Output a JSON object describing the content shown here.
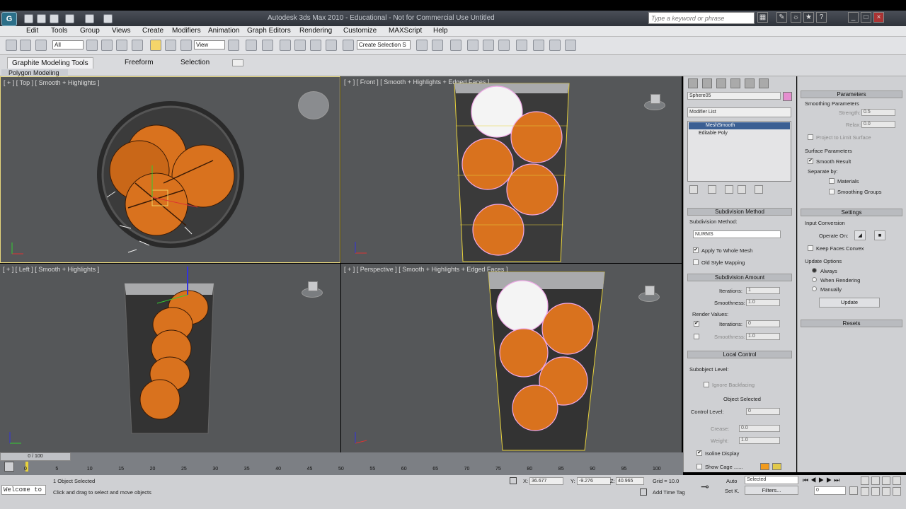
{
  "window": {
    "title": "Autodesk 3ds Max  2010 - Educational - Not for Commercial Use    Untitled",
    "search_placeholder": "Type a keyword or phrase"
  },
  "menu": [
    "Edit",
    "Tools",
    "Group",
    "Views",
    "Create",
    "Modifiers",
    "Animation",
    "Graph Editors",
    "Rendering",
    "Customize",
    "MAXScript",
    "Help"
  ],
  "toolbar": {
    "filter_value": "All",
    "view_value": "View",
    "selection_set_value": "Create Selection S"
  },
  "ribbon": {
    "tabs": [
      "Graphite Modeling Tools",
      "Freeform",
      "Selection"
    ],
    "active_tab": "Graphite Modeling Tools",
    "sub_label": "Polygon Modeling"
  },
  "viewports": {
    "top": "[ + ] [ Top ] [ Smooth + Highlights ]",
    "front": "[ + ] [ Front ] [ Smooth + Highlights + Edged Faces ]",
    "left": "[ + ] [ Left ] [ Smooth + Highlights ]",
    "perspective": "[ + ] [ Perspective ] [ Smooth + Highlights + Edged Faces ]"
  },
  "command_panel": {
    "object_name": "Sphere05",
    "object_color": "#e58ecf",
    "modifier_list_label": "Modifier List",
    "stack": [
      "MeshSmooth",
      "Editable Poly"
    ],
    "subdivision_method": {
      "header": "Subdivision Method",
      "label": "Subdivision Method:",
      "value": "NURMS",
      "apply_whole_mesh": "Apply To Whole Mesh",
      "old_style": "Old Style Mapping"
    },
    "subdivision_amount": {
      "header": "Subdivision Amount",
      "iterations_label": "Iterations:",
      "iterations": "1",
      "smoothness_label": "Smoothness:",
      "smoothness": "1.0",
      "render_values": "Render Values:",
      "r_iterations": "0",
      "r_smoothness": "1.0"
    },
    "local_control": {
      "header": "Local Control",
      "subobject": "Subobject Level:",
      "ignore_backfacing": "Ignore Backfacing",
      "object_selected": "Object Selected",
      "control_level_label": "Control Level:",
      "control_level": "0",
      "crease_label": "Crease:",
      "crease": "0.0",
      "weight_label": "Weight:",
      "weight": "1.0",
      "isoline": "Isoline Display",
      "show_cage": "Show Cage ......"
    }
  },
  "parameters_panel": {
    "header": "Parameters",
    "smoothing": "Smoothing Parameters",
    "strength_label": "Strength:",
    "strength": "0.5",
    "relax_label": "Relax:",
    "relax": "0.0",
    "project": "Project to Limit Surface",
    "surface": "Surface Parameters",
    "smooth_result": "Smooth Result",
    "separate_by": "Separate by:",
    "materials": "Materials",
    "smoothing_groups": "Smoothing Groups",
    "settings": "Settings",
    "input_conversion": "Input Conversion",
    "operate_on": "Operate On:",
    "keep_faces": "Keep Faces Convex",
    "update_options": "Update Options",
    "always": "Always",
    "when_rendering": "When Rendering",
    "manually": "Manually",
    "update_btn": "Update",
    "resets": "Resets"
  },
  "timeline": {
    "slider": "0 / 100",
    "ticks": [
      "0",
      "5",
      "10",
      "15",
      "20",
      "25",
      "30",
      "35",
      "40",
      "45",
      "50",
      "55",
      "60",
      "65",
      "70",
      "75",
      "80",
      "85",
      "90",
      "95",
      "100"
    ]
  },
  "status": {
    "welcome": "Welcome to",
    "selected": "1 Object Selected",
    "prompt": "Click and drag to select and move objects",
    "x_label": "X:",
    "x": "36.677",
    "y_label": "Y:",
    "y": "-9.276",
    "z_label": "Z:",
    "z": "40.965",
    "grid": "Grid = 10.0",
    "add_time_tag": "Add Time Tag",
    "auto": "Auto",
    "set_key": "Set K.",
    "key_mode": "Selected",
    "filters": "Filters...",
    "frame": "0"
  },
  "colors": {
    "ball": "#d9721e",
    "wire_pink": "#f0a8e8",
    "wire_yellow": "#e8d23a"
  }
}
